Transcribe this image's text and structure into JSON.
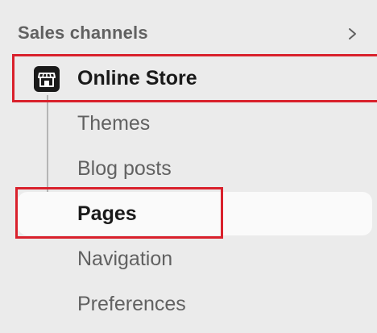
{
  "sales_channels": {
    "title": "Sales channels",
    "expand_icon": "chevron-right-icon",
    "online_store": {
      "label": "Online Store",
      "icon": "store-icon"
    },
    "sub_items": [
      {
        "label": "Themes"
      },
      {
        "label": "Blog posts"
      },
      {
        "label": "Pages",
        "selected": true
      },
      {
        "label": "Navigation"
      },
      {
        "label": "Preferences"
      }
    ]
  },
  "colors": {
    "background": "#ebebeb",
    "selected_background": "#fafafa",
    "highlight": "#d9212c",
    "primary_text": "#1a1a1a",
    "secondary_text": "#616161"
  }
}
